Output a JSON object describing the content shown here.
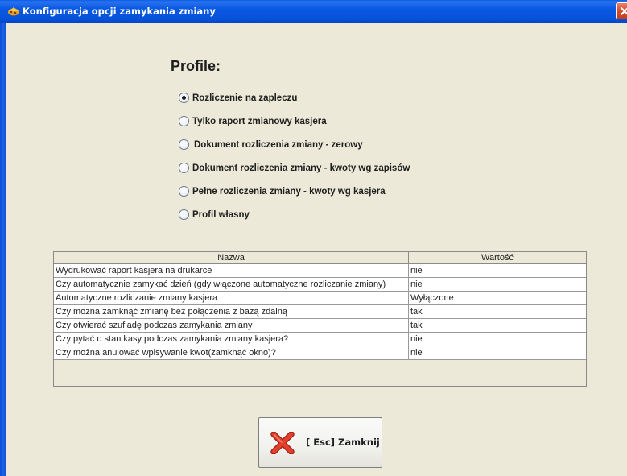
{
  "window": {
    "title": "Konfiguracja opcji zamykania zmiany"
  },
  "profiles": {
    "heading": "Profile:",
    "selected_index": 0,
    "options": [
      "Rozliczenie na zapleczu",
      "Tylko raport zmianowy kasjera",
      " Dokument rozliczenia zmiany - zerowy",
      "Dokument rozliczenia zmiany - kwoty wg zapisów",
      "Pełne rozliczenia zmiany - kwoty wg kasjera",
      "Profil własny"
    ]
  },
  "table": {
    "columns": [
      "Nazwa",
      "Wartość"
    ],
    "rows": [
      [
        "Wydrukować raport kasjera na drukarce",
        "nie"
      ],
      [
        "Czy automatycznie zamykać dzień (gdy włączone automatyczne rozliczanie zmiany)",
        "nie"
      ],
      [
        "Automatyczne rozliczanie zmiany kasjera",
        "Wyłączone"
      ],
      [
        "Czy można zamknąć zmianę bez połączenia z bazą zdalną",
        "tak"
      ],
      [
        "Czy otwierać szufladę podczas zamykania zmiany",
        "tak"
      ],
      [
        "Czy pytać o stan kasy podczas zamykania zmiany kasjera?",
        "nie"
      ],
      [
        "Czy można anulować wpisywanie kwot(zamknąć okno)?",
        "nie"
      ]
    ]
  },
  "footer": {
    "close_label": "[ Esc] Zamknij"
  },
  "icons": {
    "app": "app-icon",
    "window_close": "close-icon",
    "button_close": "red-x-icon"
  },
  "colors": {
    "titlebar": "#0752d9",
    "window_bg": "#ece9d8",
    "close_x": "#d63c2c"
  }
}
